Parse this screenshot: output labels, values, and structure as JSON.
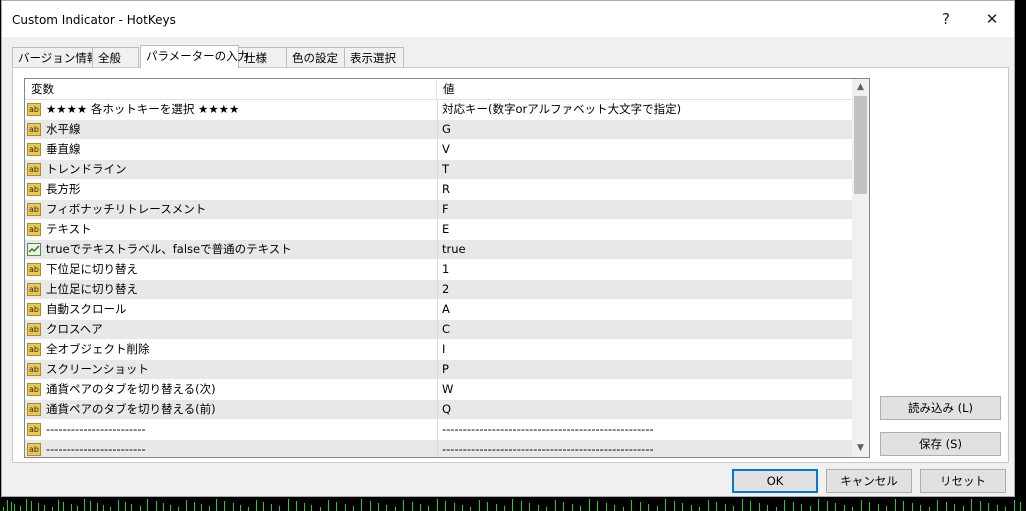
{
  "window": {
    "title": "Custom Indicator - HotKeys",
    "help_label": "?",
    "close_label": "✕"
  },
  "tabs": [
    {
      "label": "バージョン情報",
      "active": false
    },
    {
      "label": "全般",
      "active": false
    },
    {
      "label": "パラメーターの入力",
      "active": true
    },
    {
      "label": "仕様",
      "active": false
    },
    {
      "label": "色の設定",
      "active": false
    },
    {
      "label": "表示選択",
      "active": false
    }
  ],
  "table": {
    "headers": [
      "変数",
      "値"
    ],
    "rows": [
      {
        "icon": "string-param-icon",
        "name": "★★★★ 各ホットキーを選択 ★★★★",
        "value": "対応キー(数字orアルファベット大文字で指定)"
      },
      {
        "icon": "string-param-icon",
        "name": "水平線",
        "value": "G"
      },
      {
        "icon": "string-param-icon",
        "name": "垂直線",
        "value": "V"
      },
      {
        "icon": "string-param-icon",
        "name": "トレンドライン",
        "value": "T"
      },
      {
        "icon": "string-param-icon",
        "name": "長方形",
        "value": "R"
      },
      {
        "icon": "string-param-icon",
        "name": "フィボナッチリトレースメント",
        "value": "F"
      },
      {
        "icon": "string-param-icon",
        "name": "テキスト",
        "value": "E"
      },
      {
        "icon": "bool-param-icon",
        "name": "trueでテキストラベル、falseで普通のテキスト",
        "value": "true"
      },
      {
        "icon": "string-param-icon",
        "name": "下位足に切り替え",
        "value": "1"
      },
      {
        "icon": "string-param-icon",
        "name": "上位足に切り替え",
        "value": "2"
      },
      {
        "icon": "string-param-icon",
        "name": "自動スクロール",
        "value": "A"
      },
      {
        "icon": "string-param-icon",
        "name": "クロスヘア",
        "value": "C"
      },
      {
        "icon": "string-param-icon",
        "name": "全オブジェクト削除",
        "value": "I"
      },
      {
        "icon": "string-param-icon",
        "name": "スクリーンショット",
        "value": "P"
      },
      {
        "icon": "string-param-icon",
        "name": "通貨ペアのタブを切り替える(次)",
        "value": "W"
      },
      {
        "icon": "string-param-icon",
        "name": "通貨ペアのタブを切り替える(前)",
        "value": "Q"
      },
      {
        "icon": "string-param-icon",
        "name": "------------------------",
        "value": "---------------------------------------------------"
      },
      {
        "icon": "string-param-icon",
        "name": "------------------------",
        "value": "---------------------------------------------------"
      }
    ]
  },
  "side_buttons": {
    "load_label": "読み込み (L)",
    "save_label": "保存 (S)"
  },
  "footer_buttons": {
    "ok_label": "OK",
    "cancel_label": "キャンセル",
    "reset_label": "リセット"
  },
  "icon_text": {
    "string_param": "ab"
  },
  "colors": {
    "accent": "#0078d7",
    "row_alt": "#e8e8e8",
    "chart_bars": "#1fd11f"
  }
}
